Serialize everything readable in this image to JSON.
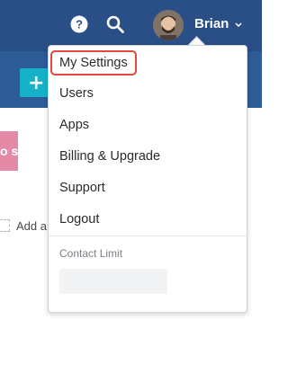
{
  "header": {
    "user_name": "Brian"
  },
  "toolbar": {
    "add_button_glyph": "+"
  },
  "background": {
    "pink_card_text": "o s...",
    "add_text": "Add a"
  },
  "menu": {
    "items": [
      {
        "label": "My Settings"
      },
      {
        "label": "Users"
      },
      {
        "label": "Apps"
      },
      {
        "label": "Billing & Upgrade"
      },
      {
        "label": "Support"
      },
      {
        "label": "Logout"
      }
    ],
    "contact_limit_label": "Contact Limit"
  },
  "colors": {
    "header_bg": "#2a4f86",
    "subheader_bg": "#2d5c97",
    "accent": "#15b2c7",
    "highlight_border": "#e8473f"
  }
}
